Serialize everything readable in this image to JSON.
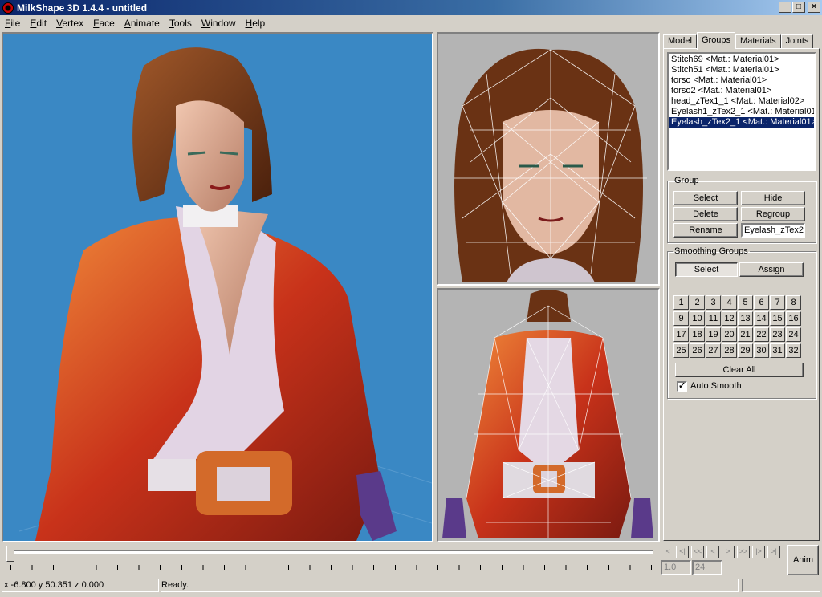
{
  "window": {
    "title": "MilkShape 3D 1.4.4 - untitled",
    "minimize": "_",
    "maximize": "□",
    "close": "×"
  },
  "menu": [
    "File",
    "Edit",
    "Vertex",
    "Face",
    "Animate",
    "Tools",
    "Window",
    "Help"
  ],
  "tabs": [
    "Model",
    "Groups",
    "Materials",
    "Joints"
  ],
  "active_tab": "Groups",
  "groups_list": [
    "Stitch69 <Mat.: Material01>",
    "Stitch51 <Mat.: Material01>",
    "torso <Mat.: Material01>",
    "torso2 <Mat.: Material01>",
    "head_zTex1_1 <Mat.: Material02>",
    "Eyelash1_zTex2_1 <Mat.: Material01>",
    "Eyelash_zTex2_1 <Mat.: Material01>"
  ],
  "selected_group_index": 6,
  "group_box": {
    "legend": "Group",
    "select": "Select",
    "hide": "Hide",
    "delete": "Delete",
    "regroup": "Regroup",
    "rename": "Rename",
    "rename_value": "Eyelash_zTex2"
  },
  "smoothing": {
    "legend": "Smoothing Groups",
    "select": "Select",
    "assign": "Assign",
    "numbers": [
      "1",
      "2",
      "3",
      "4",
      "5",
      "6",
      "7",
      "8",
      "9",
      "10",
      "11",
      "12",
      "13",
      "14",
      "15",
      "16",
      "17",
      "18",
      "19",
      "20",
      "21",
      "22",
      "23",
      "24",
      "25",
      "26",
      "27",
      "28",
      "29",
      "30",
      "31",
      "32"
    ],
    "clear_all": "Clear All",
    "auto_smooth_label": "Auto Smooth",
    "auto_smooth_checked": true
  },
  "playback": {
    "buttons": [
      "|<",
      "<|",
      "<<",
      "<",
      ">",
      ">>",
      "|>",
      ">|"
    ],
    "frame_current": "1.0",
    "frame_total": "24",
    "anim_label": "Anim"
  },
  "status": {
    "coords": "x -6.800 y 50.351 z 0.000",
    "message": "Ready."
  },
  "colors": {
    "viewport_3d_bg": "#3a88c4",
    "viewport_ortho_bg": "#b4b4b4",
    "selection": "#0a246a"
  }
}
